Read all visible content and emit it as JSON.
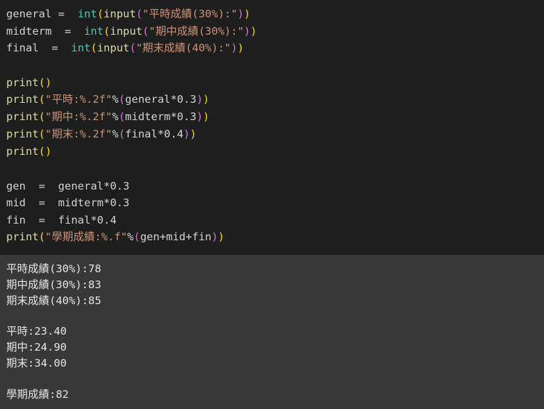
{
  "code": {
    "l1": {
      "var": "general",
      "eq": " = ",
      "type": "int",
      "open1": "(",
      "func": "input",
      "open2": "(",
      "str": "\"平時成績(30%):\"",
      "close2": ")",
      "close1": ")"
    },
    "l2": {
      "var": "midterm",
      "eq": " = ",
      "type": "int",
      "open1": "(",
      "func": "input",
      "open2": "(",
      "str": "\"期中成績(30%):\"",
      "close2": ")",
      "close1": ")"
    },
    "l3": {
      "var": "final",
      "eq": " = ",
      "type": "int",
      "open1": "(",
      "func": "input",
      "open2": "(",
      "str": "\"期末成績(40%):\"",
      "close2": ")",
      "close1": ")"
    },
    "l5": {
      "func": "print",
      "paren": "()"
    },
    "l6": {
      "func": "print",
      "open": "(",
      "str": "\"平時:%.2f\"",
      "op": "%",
      "open2": "(",
      "expr": "general*0.3",
      "close2": ")",
      "close": ")"
    },
    "l7": {
      "func": "print",
      "open": "(",
      "str": "\"期中:%.2f\"",
      "op": "%",
      "open2": "(",
      "expr": "midterm*0.3",
      "close2": ")",
      "close": ")"
    },
    "l8": {
      "func": "print",
      "open": "(",
      "str": "\"期末:%.2f\"",
      "op": "%",
      "open2": "(",
      "expr": "final*0.4",
      "close2": ")",
      "close": ")"
    },
    "l9": {
      "func": "print",
      "paren": "()"
    },
    "l11": {
      "var": "gen",
      "eq": " = ",
      "expr": "general*0.3"
    },
    "l12": {
      "var": "mid",
      "eq": " = ",
      "expr": "midterm*0.3"
    },
    "l13": {
      "var": "fin",
      "eq": " = ",
      "expr": "final*0.4"
    },
    "l14": {
      "func": "print",
      "open": "(",
      "str": "\"學期成績:%.f\"",
      "op": "%",
      "open2": "(",
      "expr": "gen+mid+fin",
      "close2": ")",
      "close": ")"
    }
  },
  "output": {
    "line1": "平時成績(30%):78",
    "line2": "期中成績(30%):83",
    "line3": "期末成績(40%):85",
    "line4": "平時:23.40",
    "line5": "期中:24.90",
    "line6": "期末:34.00",
    "line7": "學期成績:82"
  },
  "colors": {
    "editor_bg": "#1e1e1e",
    "output_bg": "#383838",
    "type": "#4ec9b0",
    "function": "#dcdcaa",
    "string": "#ce9178",
    "bracket_level1": "#ffd700",
    "bracket_level2": "#da70d6"
  }
}
